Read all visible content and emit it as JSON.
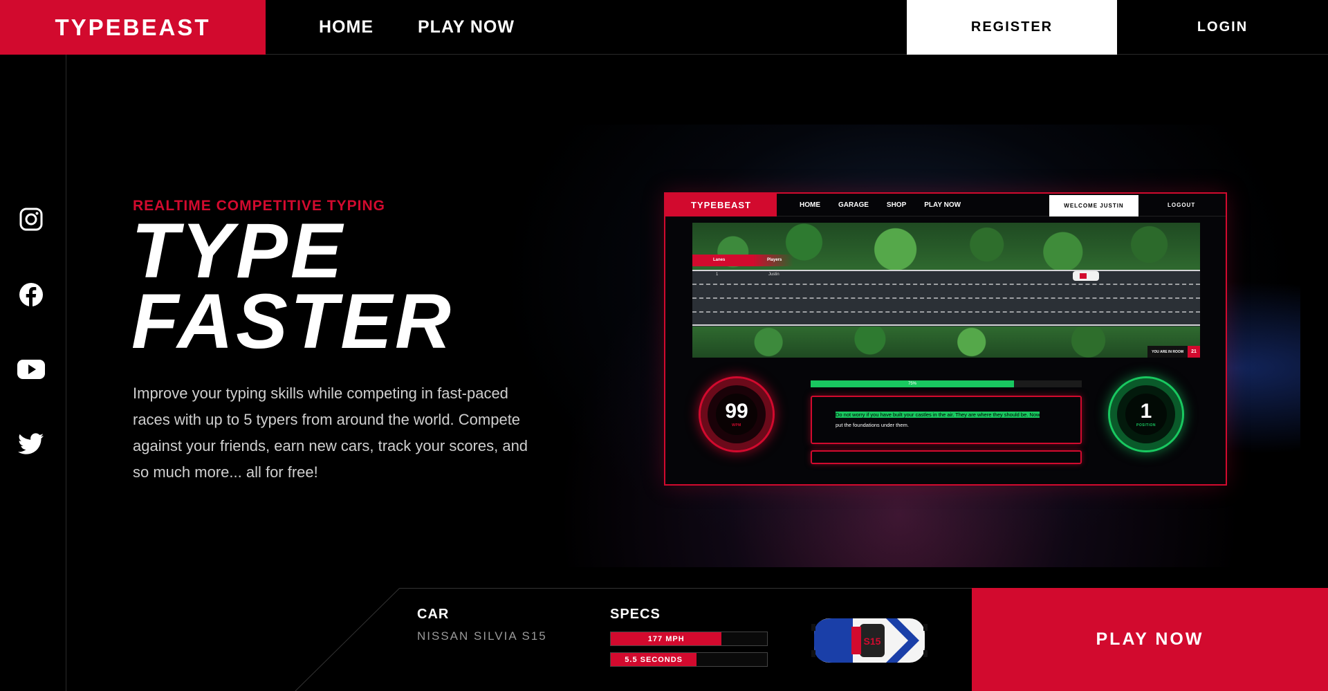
{
  "header": {
    "brand": "TYPEBEAST",
    "nav": [
      "HOME",
      "PLAY NOW"
    ],
    "register": "REGISTER",
    "login": "LOGIN"
  },
  "social": [
    "instagram-icon",
    "facebook-icon",
    "youtube-icon",
    "twitter-icon"
  ],
  "hero": {
    "kicker": "REALTIME COMPETITIVE TYPING",
    "headline_line1": "TYPE",
    "headline_line2": "FASTER",
    "description": "Improve your typing skills while competing in fast-paced races with up to 5 typers from around the world. Compete against your friends, earn new cars, track your scores, and so much more... all for free!"
  },
  "preview": {
    "brand": "TYPEBEAST",
    "nav": [
      "HOME",
      "GARAGE",
      "SHOP",
      "PLAY NOW"
    ],
    "welcome": "WELCOME JUSTIN",
    "logout": "LOGOUT",
    "lanes_label": "Lanes",
    "players_label": "Players",
    "lane_number": "1",
    "player_name": "Justin",
    "room_label": "YOU ARE IN ROOM",
    "room_number": "21",
    "wpm_value": "99",
    "wpm_label": "WPM",
    "progress_label": "75%",
    "progress": 0.75,
    "typed_text": "Do not worry if you have built your castles in the air. They are where they should be. Now",
    "remaining_text": "put the foundations under them.",
    "position_value": "1",
    "position_label": "POSITION"
  },
  "bottom": {
    "car_title": "CAR",
    "car_name": "NISSAN SILVIA S15",
    "specs_title": "SPECS",
    "spec_speed": "177 MPH",
    "spec_speed_level": 0.71,
    "spec_accel": "5.5 SECONDS",
    "spec_accel_level": 0.55,
    "play_now": "PLAY NOW"
  },
  "colors": {
    "accent": "#d20a2e",
    "success": "#19c860",
    "background": "#000000"
  }
}
